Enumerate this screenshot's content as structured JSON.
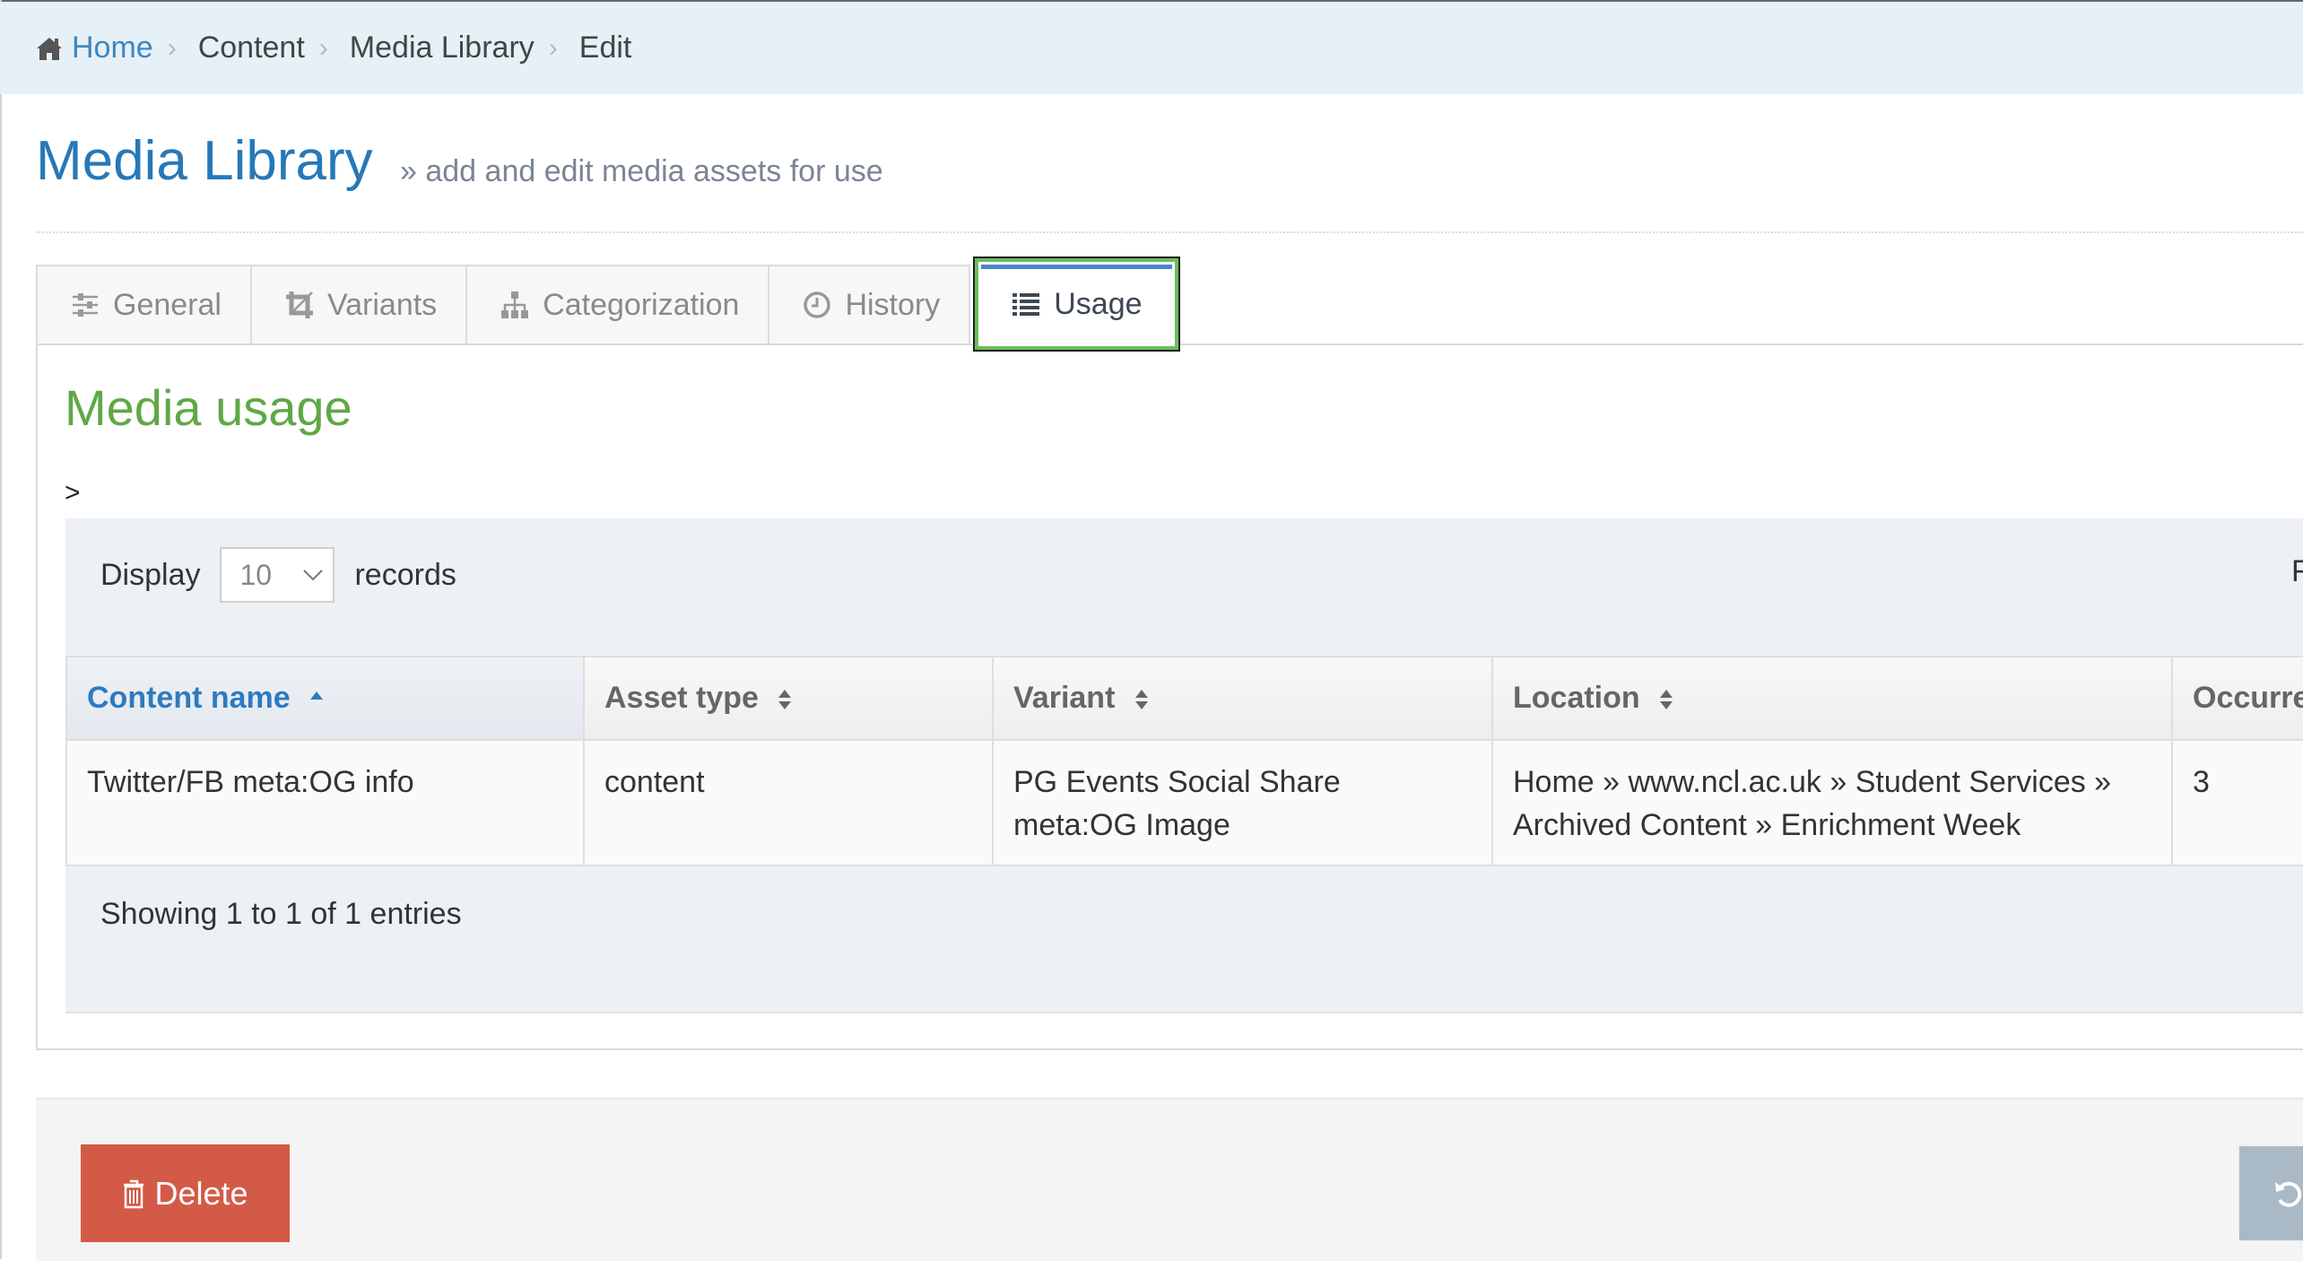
{
  "breadcrumb": {
    "items": [
      {
        "label": "Home",
        "icon": "home-icon",
        "link": true
      },
      {
        "label": "Content",
        "link": false
      },
      {
        "label": "Media Library",
        "link": false
      },
      {
        "label": "Edit",
        "link": false
      }
    ],
    "separator": "›"
  },
  "header": {
    "title": "Media Library",
    "subtitle": "» add and edit media assets for use"
  },
  "tabs": [
    {
      "label": "General",
      "icon": "sliders-icon",
      "active": false
    },
    {
      "label": "Variants",
      "icon": "crop-icon",
      "active": false
    },
    {
      "label": "Categorization",
      "icon": "sitemap-icon",
      "active": false
    },
    {
      "label": "History",
      "icon": "clock-icon",
      "active": false
    },
    {
      "label": "Usage",
      "icon": "list-icon",
      "active": true
    }
  ],
  "panel": {
    "title": "Media usage",
    "stray_text": ">"
  },
  "table_controls": {
    "display_label": "Display",
    "page_length": "10",
    "records_label": "records",
    "filter_label_partial": "F"
  },
  "table": {
    "columns": [
      {
        "label": "Content name",
        "sort": "asc"
      },
      {
        "label": "Asset type",
        "sort": "both"
      },
      {
        "label": "Variant",
        "sort": "both"
      },
      {
        "label": "Location",
        "sort": "both"
      },
      {
        "label": "Occurre",
        "sort": "none"
      }
    ],
    "rows": [
      {
        "content_name": "Twitter/FB meta:OG info",
        "asset_type": "content",
        "variant": "PG Events Social Share meta:OG Image",
        "location": "Home » www.ncl.ac.uk » Student Services » Archived Content » Enrichment Week",
        "occurrences": "3"
      }
    ],
    "info": "Showing 1 to 1 of 1 entries"
  },
  "footer": {
    "delete_label": "Delete",
    "reset_icon": "undo-icon"
  },
  "colors": {
    "link_blue": "#3c87c0",
    "title_blue": "#2678b8",
    "section_green": "#5fa846",
    "delete_red": "#d35a47",
    "reset_grey": "#a9b9c6",
    "breadcrumb_bg": "#e6f0f7"
  }
}
